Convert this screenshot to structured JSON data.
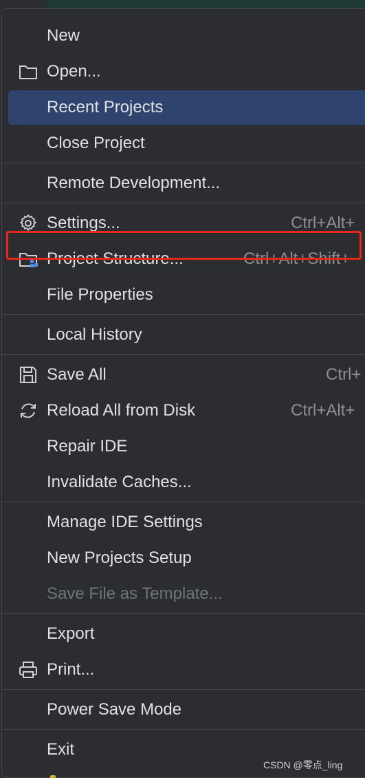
{
  "menu": {
    "items": [
      {
        "label": "New"
      },
      {
        "label": "Open...",
        "icon": "folder-icon"
      },
      {
        "label": "Recent Projects",
        "selected": true
      },
      {
        "label": "Close Project"
      },
      {
        "label": "Remote Development..."
      },
      {
        "label": "Settings...",
        "shortcut": "Ctrl+Alt+",
        "icon": "gear-icon"
      },
      {
        "label": "Project Structure...",
        "shortcut": "Ctrl+Alt+Shift+",
        "icon": "project-structure-icon"
      },
      {
        "label": "File Properties"
      },
      {
        "label": "Local History"
      },
      {
        "label": "Save All",
        "shortcut": "Ctrl+",
        "icon": "save-icon"
      },
      {
        "label": "Reload All from Disk",
        "shortcut": "Ctrl+Alt+",
        "icon": "reload-icon"
      },
      {
        "label": "Repair IDE"
      },
      {
        "label": "Invalidate Caches..."
      },
      {
        "label": "Manage IDE Settings"
      },
      {
        "label": "New Projects Setup"
      },
      {
        "label": "Save File as Template...",
        "disabled": true
      },
      {
        "label": "Export"
      },
      {
        "label": "Print...",
        "icon": "printer-icon"
      },
      {
        "label": "Power Save Mode"
      },
      {
        "label": "Exit"
      }
    ]
  },
  "watermark": "CSDN @零点_ling",
  "colors": {
    "menu_bg": "#2b2d30",
    "selected_bg": "#2e436e",
    "highlight_border": "#e8261b",
    "text": "#dfe1e5",
    "shortcut_text": "#8c8f94",
    "disabled_text": "#6f737a"
  }
}
